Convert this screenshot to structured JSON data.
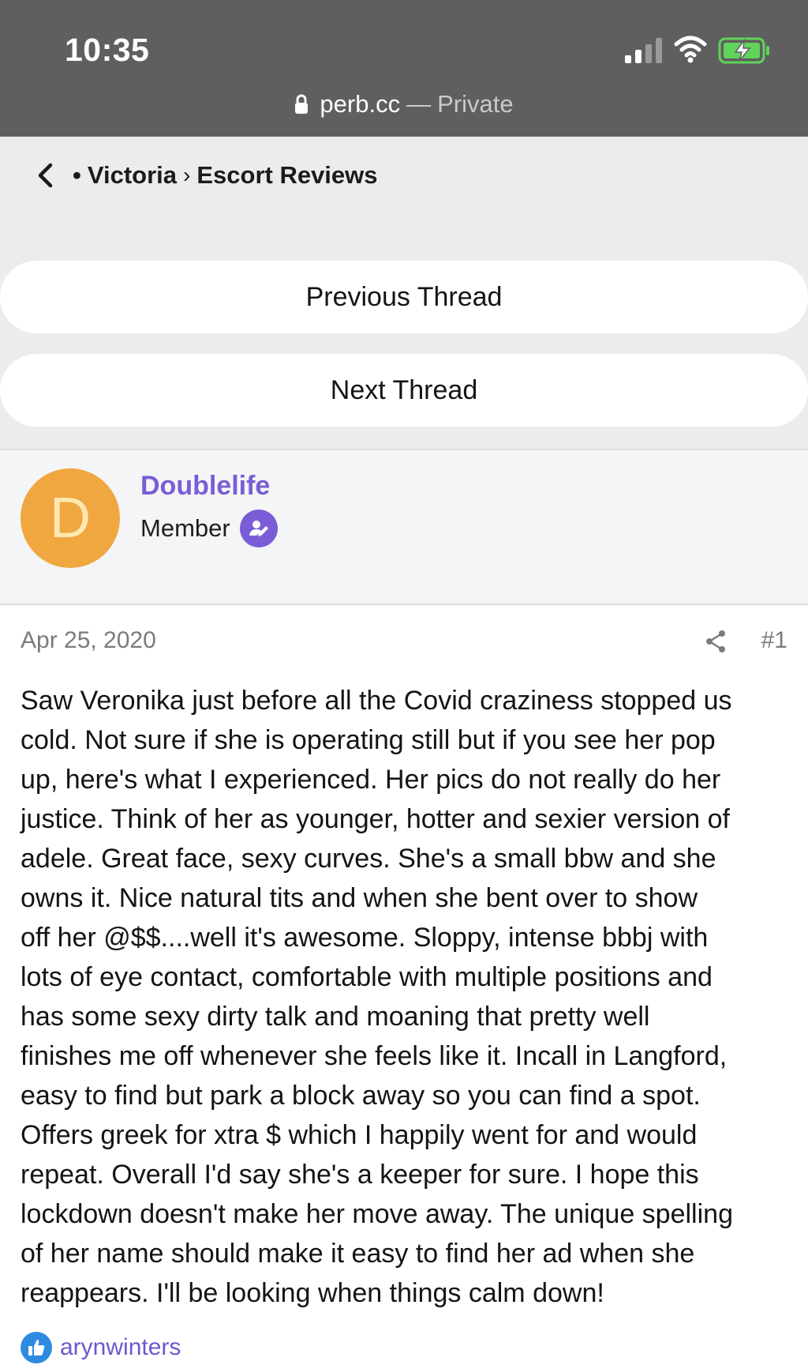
{
  "status_bar": {
    "time": "10:35",
    "url_domain": "perb.cc",
    "url_separator": "—",
    "url_mode": "Private",
    "battery_color": "#5fd35a"
  },
  "breadcrumb": {
    "dot": "•",
    "section": "Victoria",
    "chevron": "›",
    "forum": "Escort Reviews"
  },
  "navigation": {
    "previous_thread": "Previous Thread",
    "next_thread": "Next Thread"
  },
  "author": {
    "avatar_letter": "D",
    "avatar_color": "#f0a740",
    "username": "Doublelife",
    "role": "Member",
    "accent_color": "#7a5dd6"
  },
  "post": {
    "date": "Apr 25, 2020",
    "number": "#1",
    "body": "Saw Veronika just before all the Covid craziness stopped us\ncold. Not sure if she is operating still but if you see her pop\nup, here's what I experienced. Her pics do not really do her\njustice. Think of her as younger, hotter and sexier version of\nadele. Great face, sexy curves. She's a small bbw and she\nowns it. Nice natural tits and when she bent over to show\noff her @$$....well it's awesome. Sloppy, intense bbbj with\nlots of eye contact, comfortable with multiple positions and\nhas some sexy dirty talk and moaning that pretty well\nfinishes me off whenever she feels like it. Incall in Langford,\neasy to find but park a block away so you can find a spot.\nOffers greek for xtra $ which I happily went for and would\nrepeat. Overall I'd say she's a keeper for sure. I hope this\nlockdown doesn't make her move away. The unique spelling\nof her name should make it easy to find her ad when she\nreappears. I'll be looking when things calm down!"
  },
  "reactions": {
    "icon": "thumbs-up-icon",
    "user": "arynwinters"
  }
}
